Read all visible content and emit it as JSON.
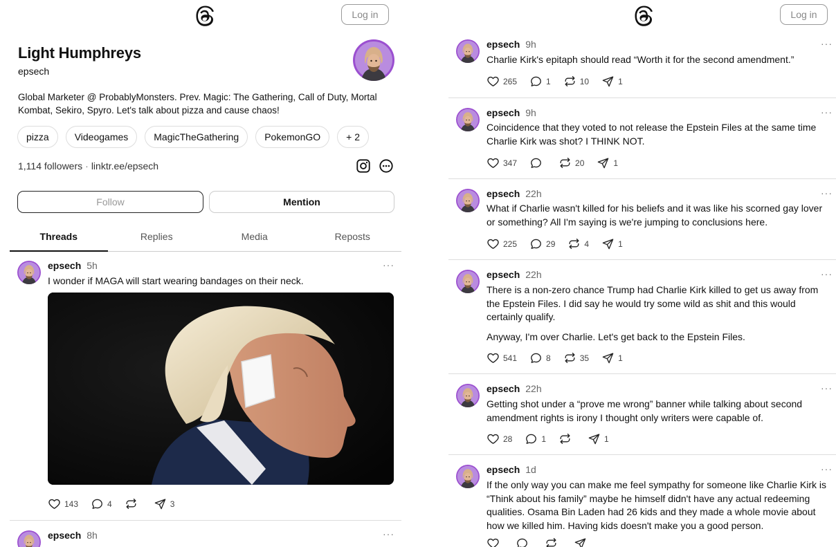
{
  "app": {
    "login_label": "Log in"
  },
  "profile": {
    "name": "Light Humphreys",
    "handle": "epsech",
    "bio_line1": "Global Marketer @ ProbablyMonsters. Prev. Magic: The Gathering, Call of Duty, Mortal",
    "bio_line2": "Kombat, Sekiro, Spyro. Let's talk about pizza and cause chaos!",
    "tags": [
      "pizza",
      "Videogames",
      "MagicTheGathering",
      "PokemonGO",
      "+ 2"
    ],
    "followers": "1,114 followers",
    "separator": "·",
    "link": "linktr.ee/epsech",
    "follow_label": "Follow",
    "mention_label": "Mention"
  },
  "tabs": [
    "Threads",
    "Replies",
    "Media",
    "Reposts"
  ],
  "left_posts": [
    {
      "user": "epsech",
      "time": "5h",
      "text": "I wonder if MAGA will start wearing bandages on their neck.",
      "likes": "143",
      "replies": "4",
      "reposts": "",
      "shares": "3"
    },
    {
      "user": "epsech",
      "time": "8h"
    }
  ],
  "right_posts": [
    {
      "user": "epsech",
      "time": "9h",
      "lines": [
        "Charlie Kirk's epitaph should read “Worth it for the second amendment.”"
      ],
      "likes": "265",
      "replies": "1",
      "reposts": "10",
      "shares": "1"
    },
    {
      "user": "epsech",
      "time": "9h",
      "lines": [
        "Coincidence that they voted to not release the Epstein Files at the same time Charlie Kirk was shot? I THINK NOT."
      ],
      "likes": "347",
      "replies": "",
      "reposts": "20",
      "shares": "1"
    },
    {
      "user": "epsech",
      "time": "22h",
      "lines": [
        "What if Charlie wasn't killed for his beliefs and it was like his scorned gay lover or something? All I'm saying is we're jumping to conclusions here."
      ],
      "likes": "225",
      "replies": "29",
      "reposts": "4",
      "shares": "1"
    },
    {
      "user": "epsech",
      "time": "22h",
      "lines": [
        "There is a non-zero chance Trump had Charlie Kirk killed to get us away from the Epstein Files. I did say he would try some wild as shit and this would certainly qualify.",
        "Anyway, I'm over Charlie. Let's get back to the Epstein Files."
      ],
      "likes": "541",
      "replies": "8",
      "reposts": "35",
      "shares": "1"
    },
    {
      "user": "epsech",
      "time": "22h",
      "lines": [
        "Getting shot under a “prove me wrong” banner while talking about second amendment rights is irony I thought only writers were capable of."
      ],
      "likes": "28",
      "replies": "1",
      "reposts": "",
      "shares": "1"
    },
    {
      "user": "epsech",
      "time": "1d",
      "lines": [
        "If the only way you can make me feel sympathy for someone like Charlie Kirk is “Think about his family” maybe he himself didn't have any actual redeeming qualities. Osama Bin Laden had 26 kids and they made a whole movie about how we killed him. Having kids doesn't make you a good person."
      ],
      "likes": "",
      "replies": "",
      "reposts": "",
      "shares": ""
    }
  ],
  "more_label": "···",
  "icons": {
    "logo": "threads-logo-icon",
    "like": "heart-icon",
    "reply": "comment-icon",
    "repost": "repost-icon",
    "share": "send-icon",
    "instagram": "instagram-icon",
    "more": "more-icon"
  },
  "colors": {
    "avatar_bg": "#8e44c9",
    "text": "#111111",
    "muted": "#666666"
  }
}
